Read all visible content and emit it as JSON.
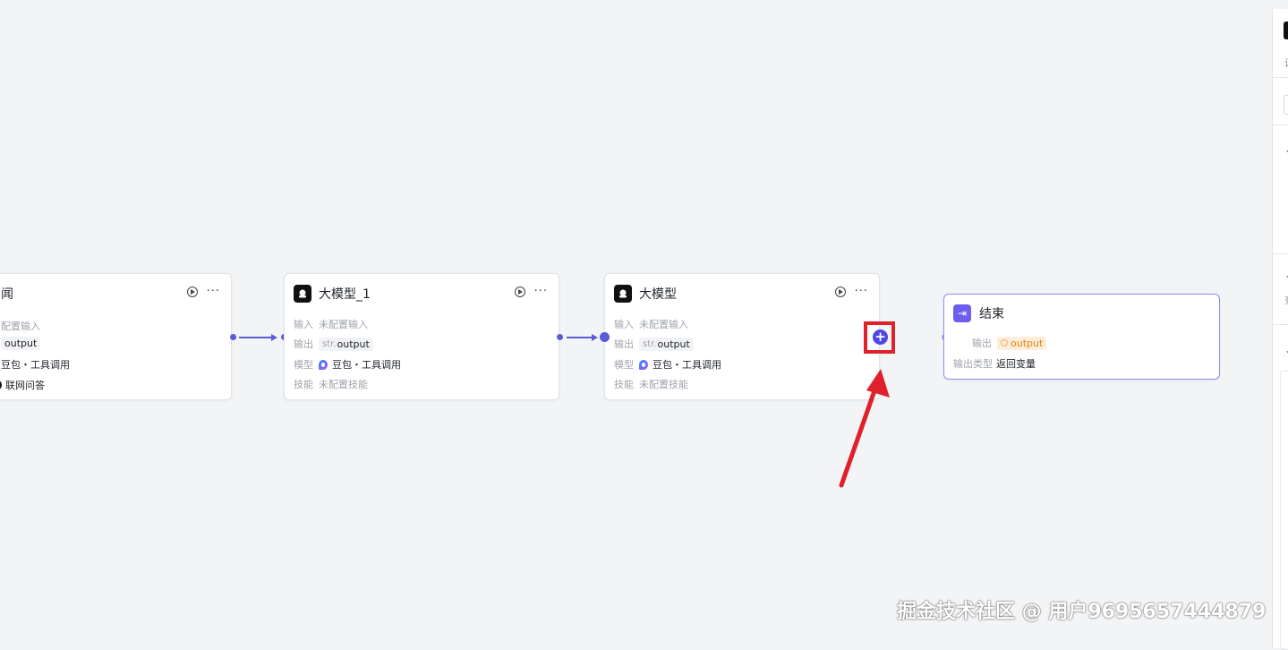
{
  "nodes": {
    "news": {
      "title": "新闻",
      "title_visible": "闻",
      "input_value_visible": "配置输入",
      "output_prefix": "str.",
      "output_var": "output",
      "model": "豆包・工具调用",
      "skill": "联网问答"
    },
    "llm1": {
      "title": "大模型_1",
      "input_label": "输入",
      "input_value": "未配置输入",
      "output_label": "输出",
      "output_prefix": "str.",
      "output_var": "output",
      "model_label": "模型",
      "model": "豆包・工具调用",
      "skill_label": "技能",
      "skill": "未配置技能"
    },
    "llm": {
      "title": "大模型",
      "input_label": "输入",
      "input_value": "未配置输入",
      "output_label": "输出",
      "output_prefix": "str.",
      "output_var": "output",
      "model_label": "模型",
      "model": "豆包・工具调用",
      "skill_label": "技能",
      "skill": "未配置技能"
    },
    "end": {
      "title": "结束",
      "output_label": "输出",
      "output_var": "output",
      "output_type_label": "输出类型",
      "output_type": "返回变量"
    }
  },
  "add_button": {
    "symbol": "+"
  },
  "right_panel": {
    "text": "设",
    "small_text": "变"
  },
  "watermark": "掘金技术社区 @ 用户9695657444879",
  "colors": {
    "accent": "#5b5bd6",
    "highlight": "#e0202a",
    "end_node_border": "#8b8ff0",
    "output_tag": "#e8840c"
  }
}
